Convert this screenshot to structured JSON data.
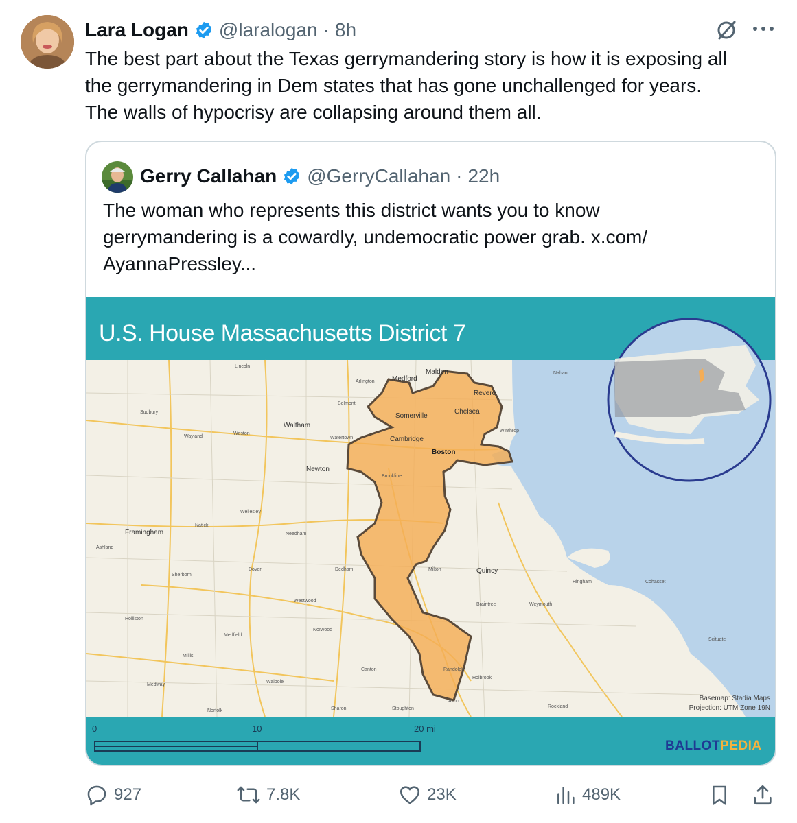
{
  "post": {
    "author_name": "Lara Logan",
    "author_handle": "@laralogan",
    "time": "8h",
    "separator": "·",
    "text_line1": "The best part about the Texas gerrymandering story is how it is exposing all",
    "text_line2": "the gerrymandering in Dem states that has gone unchallenged for years.",
    "text_line3": "The walls of hypocrisy are collapsing around them all."
  },
  "quoted": {
    "author_name": "Gerry Callahan",
    "author_handle": "@GerryCallahan",
    "time": "22h",
    "separator": "·",
    "text_line1": "The woman who represents this district wants you to know",
    "text_line2": "gerrymandering is a cowardly, undemocratic power grab.  x.com/",
    "text_line3": "AyannaPressley..."
  },
  "map": {
    "title": "U.S. House Massachusetts District 7",
    "places": {
      "medford": "Medford",
      "malden": "Malden",
      "revere": "Revere",
      "somerville": "Somerville",
      "chelsea": "Chelsea",
      "waltham": "Waltham",
      "cambridge": "Cambridge",
      "boston": "Boston",
      "newton": "Newton",
      "framingham": "Framingham",
      "quincy": "Quincy",
      "milton": "Milton",
      "braintree": "Braintree",
      "weymouth": "Weymouth",
      "hingham": "Hingham",
      "nahant": "Nahant",
      "randolph": "Randolph",
      "needham": "Needham",
      "dedham": "Dedham",
      "norwood": "Norwood",
      "canton": "Canton",
      "sharon": "Sharon",
      "stoughton": "Stoughton",
      "avon": "Avon",
      "holbrook": "Holbrook",
      "walpole": "Walpole",
      "westwood": "Westwood",
      "wellesley": "Wellesley",
      "natick": "Natick",
      "sudbury": "Sudbury",
      "wayland": "Wayland",
      "weston": "Weston",
      "belmont": "Belmont",
      "arlington": "Arlington",
      "watertown": "Watertown",
      "brookline": "Brookline",
      "winthrop": "Winthrop",
      "dover": "Dover",
      "sherborn": "Sherborn",
      "medfield": "Medfield",
      "millis": "Millis",
      "holliston": "Holliston",
      "ashland": "Ashland",
      "norfolk": "Norfolk",
      "cohasset": "Cohasset",
      "scituate": "Scituate",
      "rockland": "Rockland",
      "lincoln": "Lincoln",
      "medway": "Medway"
    },
    "credit_line1": "Basemap: Stadia Maps",
    "credit_line2": "Projection: UTM Zone 19N",
    "scale_0": "0",
    "scale_10": "10",
    "scale_20": "20 mi",
    "brand_ballot": "BALLOT",
    "brand_pedia": "PEDIA",
    "colors": {
      "teal": "#2aa7b2",
      "district": "#f4ad56",
      "water": "#b9d3ea",
      "land": "#f3f0e6"
    }
  },
  "actions": {
    "replies": "927",
    "reposts": "7.8K",
    "likes": "23K",
    "views": "489K"
  },
  "icons": {
    "grok": "grok-icon",
    "more": "more-icon",
    "reply": "reply-icon",
    "repost": "repost-icon",
    "like": "like-icon",
    "views": "views-icon",
    "bookmark": "bookmark-icon",
    "share": "share-icon",
    "verified": "verified-badge-icon"
  }
}
